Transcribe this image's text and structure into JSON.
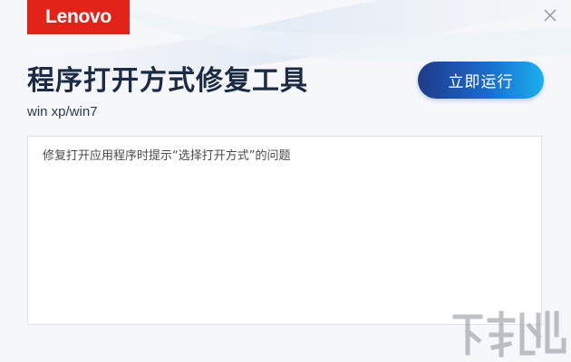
{
  "logo": {
    "text": "Lenovo"
  },
  "header": {
    "title": "程序打开方式修复工具",
    "subtitle": "win xp/win7"
  },
  "actions": {
    "run_label": "立即运行"
  },
  "description": {
    "text": "修复打开应用程序时提示“选择打开方式”的问题"
  },
  "colors": {
    "brand_red": "#e2231a",
    "title_dark": "#1c2b44",
    "button_start": "#1f3a8a",
    "button_end": "#1ab0f0"
  },
  "icons": {
    "close": "close-icon"
  }
}
